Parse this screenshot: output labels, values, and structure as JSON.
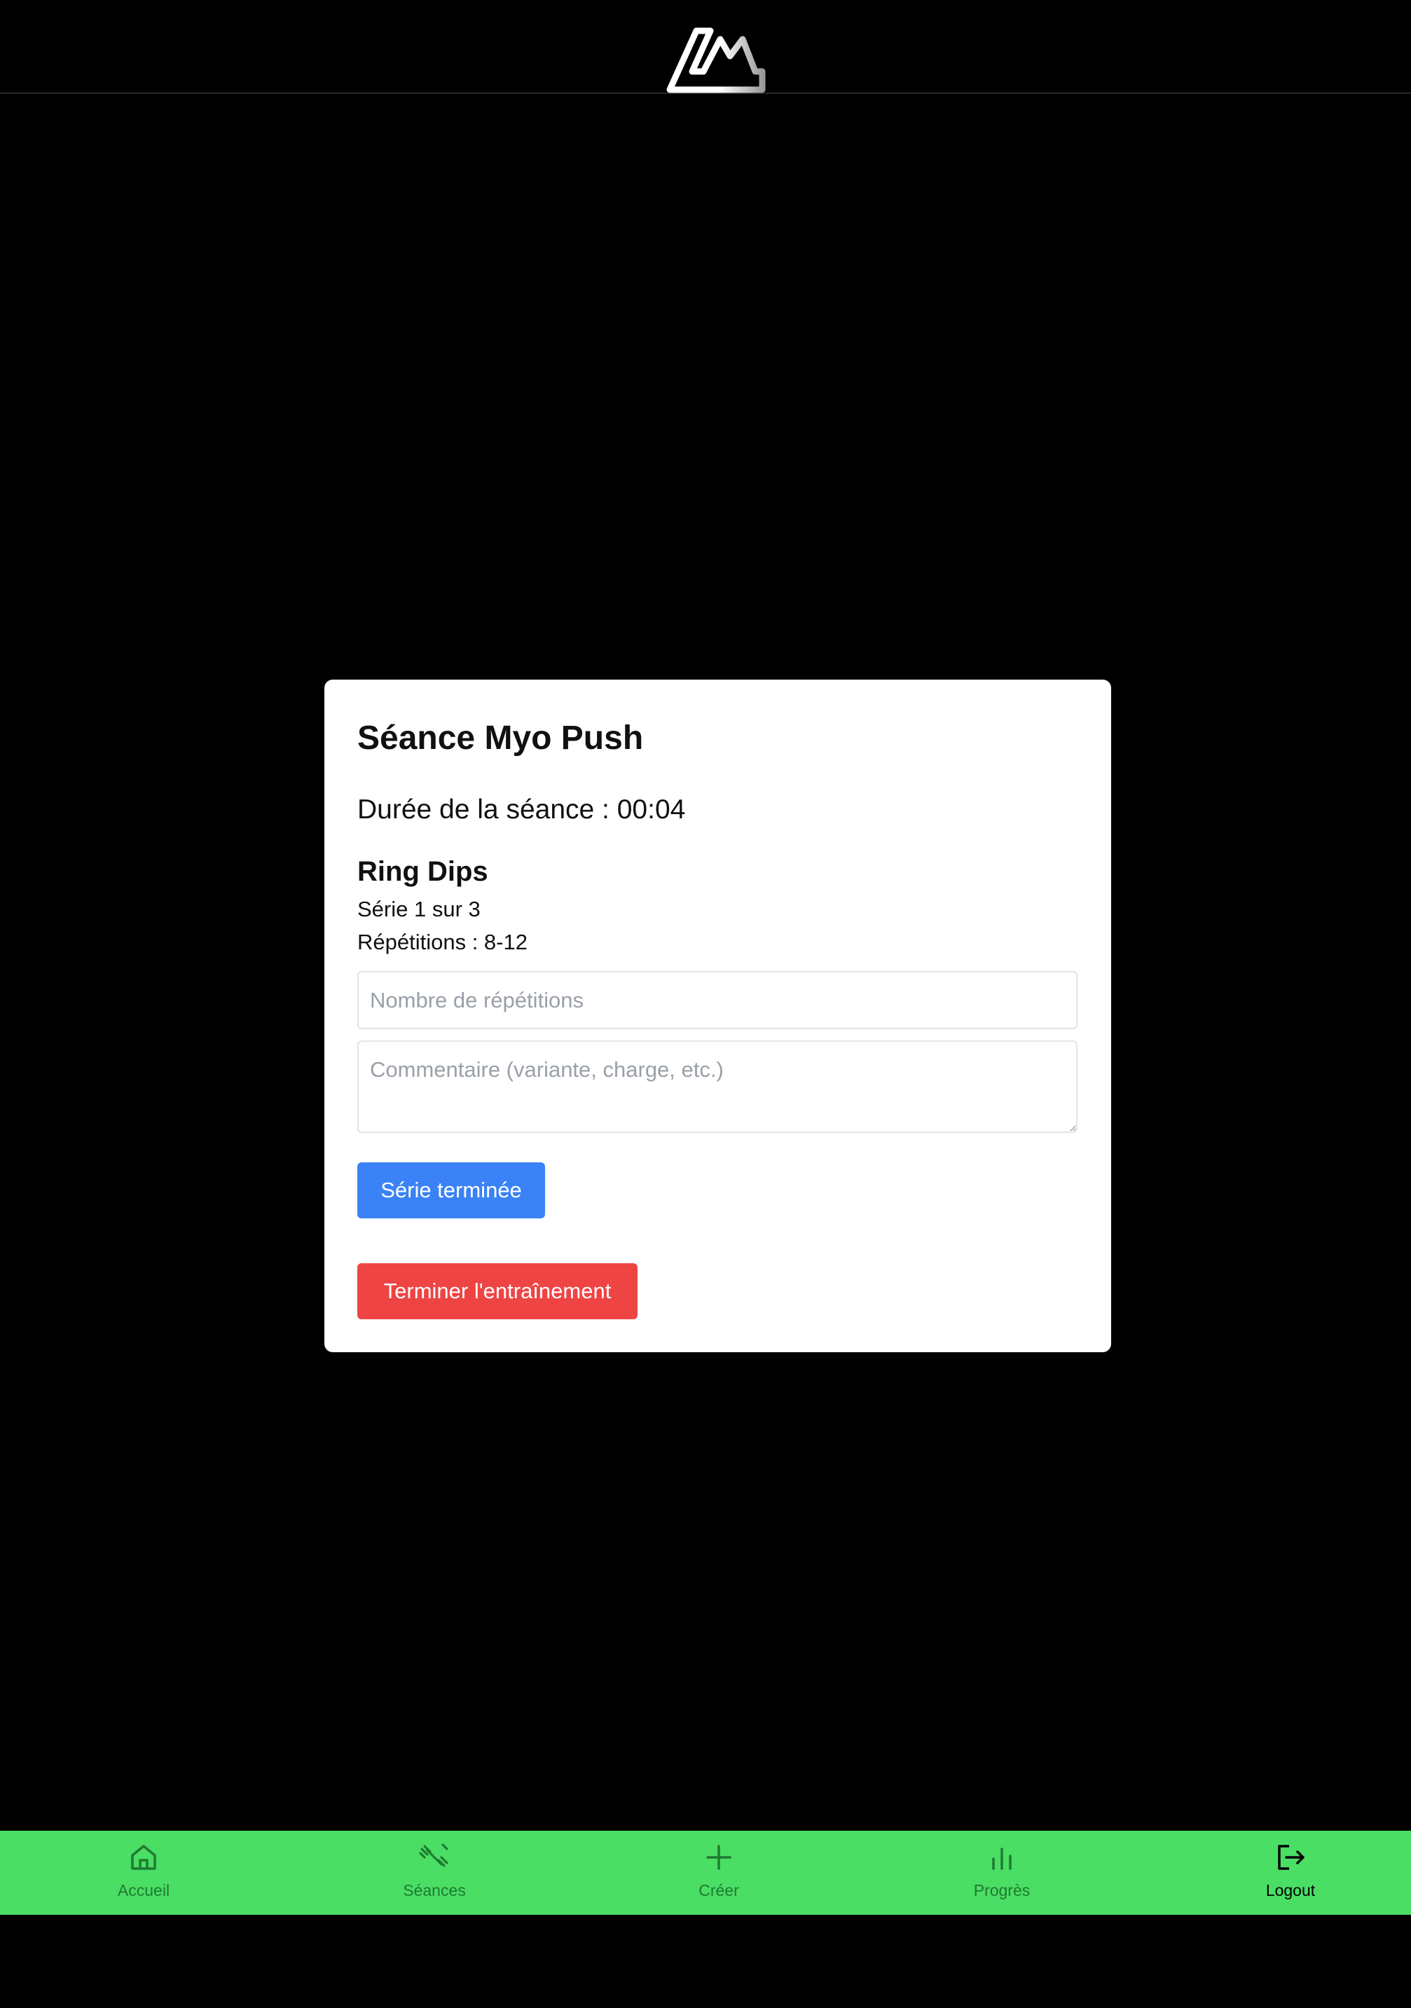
{
  "header": {
    "logo_name": "app-logo"
  },
  "session": {
    "title": "Séance Myo Push",
    "duration_text": "Durée de la séance : 00:04",
    "exercise": {
      "name": "Ring Dips",
      "serie_text": "Série 1 sur 3",
      "reps_text": "Répétitions : 8-12"
    },
    "reps_input": {
      "value": "",
      "placeholder": "Nombre de répétitions"
    },
    "comment_input": {
      "value": "",
      "placeholder": "Commentaire (variante, charge, etc.)"
    },
    "serie_done_label": "Série terminée",
    "finish_label": "Terminer l'entraînement"
  },
  "bottom_nav": {
    "items": [
      {
        "label": "Accueil",
        "icon": "home-icon",
        "active": false
      },
      {
        "label": "Séances",
        "icon": "dumbbell-icon",
        "active": false
      },
      {
        "label": "Créer",
        "icon": "plus-icon",
        "active": false
      },
      {
        "label": "Progrès",
        "icon": "bar-chart-icon",
        "active": false
      },
      {
        "label": "Logout",
        "icon": "logout-icon",
        "active": true
      }
    ]
  },
  "colors": {
    "background": "#000000",
    "card": "#ffffff",
    "primary_button": "#3b82f6",
    "danger_button": "#ef4444",
    "nav_background": "#4ade64",
    "nav_inactive": "#1f7a31",
    "nav_active": "#000000"
  }
}
